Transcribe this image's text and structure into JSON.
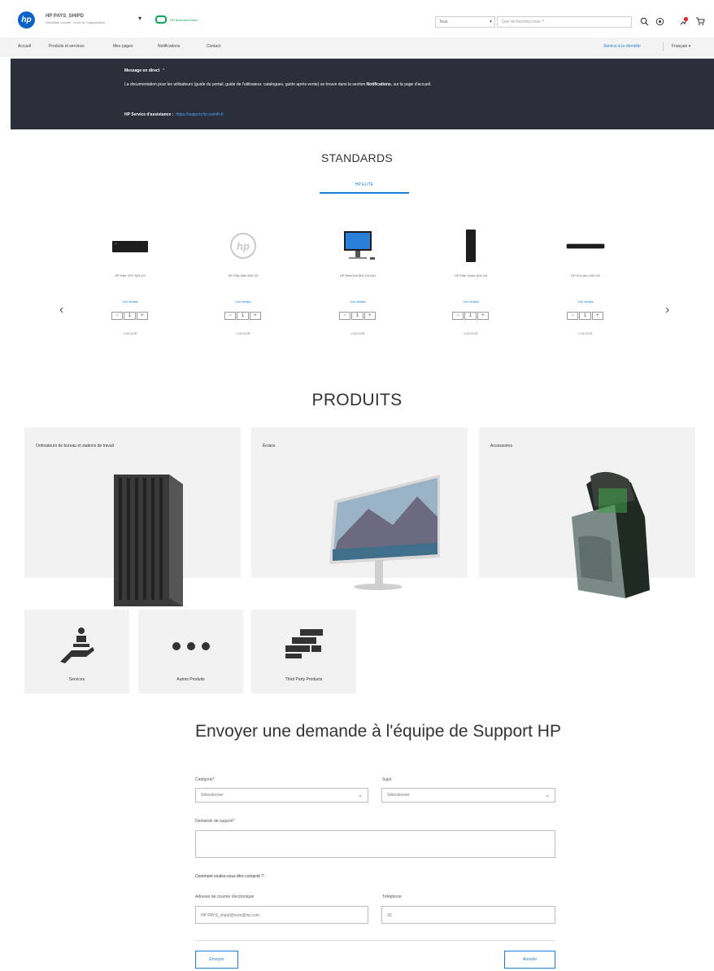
{
  "header": {
    "logo_text": "hp",
    "account_name": "HP PAYS_SHIPD",
    "account_sub": "Identifiant société · Nom de l'organisation",
    "brand_text": "HP Business Direct",
    "search_category": "Tous",
    "search_placeholder": "Que recherchez-vous ?",
    "icons": [
      "search-icon",
      "help-icon",
      "notification-icon",
      "cart-icon"
    ]
  },
  "nav": {
    "items": [
      "Accueil",
      "Produits et services",
      "Mes pages",
      "Notifications",
      "Contact"
    ],
    "right_link": "Service à la clientèle",
    "lang": "Français"
  },
  "banner": {
    "title": "Message en direct",
    "body_text": "La documentation pour les utilisateurs (guide du portail, guide de l'utilisateur, catalogues, guide après-vente) se trouve dans la section",
    "body_bold": "Notifications",
    "body_tail": ", sur la page d'accueil.",
    "service_label": "HP Service d'assistance :",
    "service_link": "https://support.hp.com/fr-fr"
  },
  "standards": {
    "heading": "STANDARDS",
    "tab": "HP ELITE",
    "products": [
      {
        "name": "HP Elite SFF 800 G9",
        "link": "Voir détails",
        "qty": "1",
        "price": "0,00 EUR",
        "img": "sff-desktop"
      },
      {
        "name": "HP Elite Mini 800 G9",
        "link": "Voir détails",
        "qty": "1",
        "price": "0,00 EUR",
        "img": "hp-logo-placeholder"
      },
      {
        "name": "HP EliteOne 800 G9 AIO",
        "link": "Voir détails",
        "qty": "1",
        "price": "0,00 EUR",
        "img": "all-in-one"
      },
      {
        "name": "HP Elite Tower 800 G9",
        "link": "Voir détails",
        "qty": "1",
        "price": "0,00 EUR",
        "img": "tower"
      },
      {
        "name": "HP Pro Mini 400 G9",
        "link": "Voir détails",
        "qty": "1",
        "price": "0,00 EUR",
        "img": "mini-desktop"
      }
    ]
  },
  "products": {
    "heading": "PRODUITS",
    "categories": [
      {
        "label": "Ordinateurs de bureau et stations de travail"
      },
      {
        "label": "Écrans"
      },
      {
        "label": "Accessoires"
      }
    ],
    "small_categories": [
      {
        "label": "Services"
      },
      {
        "label": "Autres Produits"
      },
      {
        "label": "Third Party Products"
      }
    ]
  },
  "form": {
    "title": "Envoyer une demande à l'équipe de Support HP",
    "category_label": "Catégorie*",
    "category_value": "Sélectionner",
    "subject_label": "Sujet",
    "subject_value": "Sélectionner",
    "request_label": "Demande de support*",
    "contact_heading": "Comment voulez-vous être contacté ?",
    "email_label": "Adresse de courrier électronique",
    "email_value": "HP PAYS_shipd@nom@hp.com",
    "phone_label": "Téléphone",
    "phone_value": "33",
    "send_button": "Envoyer",
    "cancel_button": "Annuler"
  },
  "colors": {
    "accent": "#1a7fd6",
    "banner_bg": "#2b2f3a",
    "card_bg": "#f2f2f2",
    "brand_green": "#0aa35a"
  }
}
